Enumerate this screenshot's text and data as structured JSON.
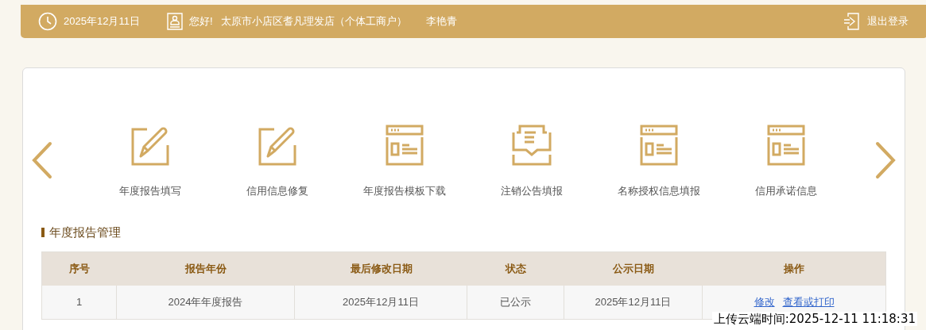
{
  "header": {
    "date": "2025年12月11日",
    "greeting": "您好!",
    "company": "太原市小店区耆凡理发店（个体工商户）",
    "user": "李艳青",
    "logout": "退出登录"
  },
  "shortcuts": [
    {
      "kind": "edit",
      "label": "年度报告填写"
    },
    {
      "kind": "edit",
      "label": "信用信息修复"
    },
    {
      "kind": "template",
      "label": "年度报告模板下载"
    },
    {
      "kind": "inbox",
      "label": "注销公告填报"
    },
    {
      "kind": "template",
      "label": "名称授权信息填报"
    },
    {
      "kind": "template",
      "label": "信用承诺信息"
    }
  ],
  "section_title": "年度报告管理",
  "table": {
    "columns": [
      "序号",
      "报告年份",
      "最后修改日期",
      "状态",
      "公示日期",
      "操作"
    ],
    "rows": [
      {
        "cells": [
          "1",
          "2024年年度报告",
          "2025年12月11日",
          "已公示",
          "2025年12月11日"
        ],
        "actions": [
          "修改",
          "查看或打印"
        ]
      }
    ]
  },
  "upload_stamp": "上传云端时间:2025-12-11 11:18:31"
}
